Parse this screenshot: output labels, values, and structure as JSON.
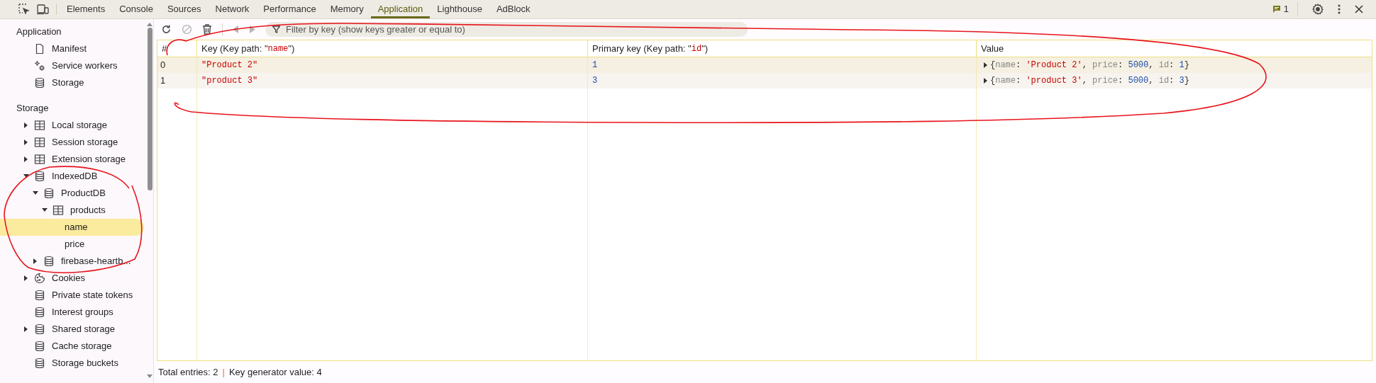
{
  "toolbar_tabs": [
    {
      "label": "Elements",
      "selected": false
    },
    {
      "label": "Console",
      "selected": false
    },
    {
      "label": "Sources",
      "selected": false
    },
    {
      "label": "Network",
      "selected": false
    },
    {
      "label": "Performance",
      "selected": false
    },
    {
      "label": "Memory",
      "selected": false
    },
    {
      "label": "Application",
      "selected": true
    },
    {
      "label": "Lighthouse",
      "selected": false
    },
    {
      "label": "AdBlock",
      "selected": false
    }
  ],
  "issues_count": "1",
  "sidebar": {
    "sections": [
      {
        "title": "Application",
        "items": [
          {
            "label": "Manifest",
            "kind": "file",
            "selected": false
          },
          {
            "label": "Service workers",
            "kind": "gears",
            "selected": false
          },
          {
            "label": "Storage",
            "kind": "database",
            "selected": false
          }
        ]
      },
      {
        "title": "Storage",
        "items": [
          {
            "label": "Local storage",
            "kind": "table",
            "expanded": false,
            "selected": false
          },
          {
            "label": "Session storage",
            "kind": "table",
            "expanded": false,
            "selected": false
          },
          {
            "label": "Extension storage",
            "kind": "table",
            "expanded": false,
            "selected": false
          },
          {
            "label": "IndexedDB",
            "kind": "database",
            "expanded": true,
            "selected": false,
            "children": [
              {
                "label": "ProductDB",
                "kind": "database",
                "expanded": true,
                "selected": false,
                "children": [
                  {
                    "label": "products",
                    "kind": "table",
                    "expanded": true,
                    "selected": false,
                    "children": [
                      {
                        "label": "name",
                        "kind": "leaf",
                        "selected": true
                      },
                      {
                        "label": "price",
                        "kind": "leaf",
                        "selected": false
                      }
                    ]
                  }
                ]
              },
              {
                "label": "firebase-heartb...",
                "kind": "database",
                "expanded": false,
                "selected": false
              }
            ]
          },
          {
            "label": "Cookies",
            "kind": "cookie",
            "expanded": false,
            "selected": false
          },
          {
            "label": "Private state tokens",
            "kind": "database",
            "selected": false
          },
          {
            "label": "Interest groups",
            "kind": "database",
            "selected": false
          },
          {
            "label": "Shared storage",
            "kind": "database",
            "expanded": false,
            "selected": false
          },
          {
            "label": "Cache storage",
            "kind": "database",
            "selected": false
          },
          {
            "label": "Storage buckets",
            "kind": "database",
            "selected": false
          }
        ]
      }
    ]
  },
  "filter": {
    "placeholder": "Filter by key (show keys greater or equal to)"
  },
  "table": {
    "columns": [
      {
        "parts": [
          {
            "text": "#",
            "kind": "plain"
          }
        ]
      },
      {
        "parts": [
          {
            "text": "Key (Key path: \"",
            "kind": "plain"
          },
          {
            "text": "name",
            "kind": "code"
          },
          {
            "text": "\")",
            "kind": "plain"
          }
        ]
      },
      {
        "parts": [
          {
            "text": "Primary key (Key path: \"",
            "kind": "plain"
          },
          {
            "text": "id",
            "kind": "code"
          },
          {
            "text": "\")",
            "kind": "plain"
          }
        ]
      },
      {
        "parts": [
          {
            "text": "Value",
            "kind": "plain"
          }
        ]
      }
    ],
    "rows": [
      {
        "index": "0",
        "key": "\"Product 2\"",
        "primary_key": "1",
        "value": [
          {
            "text": "{",
            "kind": "punct"
          },
          {
            "text": "name",
            "kind": "prop"
          },
          {
            "text": ": ",
            "kind": "punct"
          },
          {
            "text": "'Product 2'",
            "kind": "string"
          },
          {
            "text": ", ",
            "kind": "punct"
          },
          {
            "text": "price",
            "kind": "prop"
          },
          {
            "text": ": ",
            "kind": "punct"
          },
          {
            "text": "5000",
            "kind": "number"
          },
          {
            "text": ", ",
            "kind": "punct"
          },
          {
            "text": "id",
            "kind": "prop"
          },
          {
            "text": ": ",
            "kind": "punct"
          },
          {
            "text": "1",
            "kind": "number"
          },
          {
            "text": "}",
            "kind": "punct"
          }
        ]
      },
      {
        "index": "1",
        "key": "\"product 3\"",
        "primary_key": "3",
        "value": [
          {
            "text": "{",
            "kind": "punct"
          },
          {
            "text": "name",
            "kind": "prop"
          },
          {
            "text": ": ",
            "kind": "punct"
          },
          {
            "text": "'product 3'",
            "kind": "string"
          },
          {
            "text": ", ",
            "kind": "punct"
          },
          {
            "text": "price",
            "kind": "prop"
          },
          {
            "text": ": ",
            "kind": "punct"
          },
          {
            "text": "5000",
            "kind": "number"
          },
          {
            "text": ", ",
            "kind": "punct"
          },
          {
            "text": "id",
            "kind": "prop"
          },
          {
            "text": ": ",
            "kind": "punct"
          },
          {
            "text": "3",
            "kind": "number"
          },
          {
            "text": "}",
            "kind": "punct"
          }
        ]
      }
    ]
  },
  "status_bar": {
    "total": "Total entries: 2",
    "separator": "|",
    "key_generator": "Key generator value: 4"
  }
}
